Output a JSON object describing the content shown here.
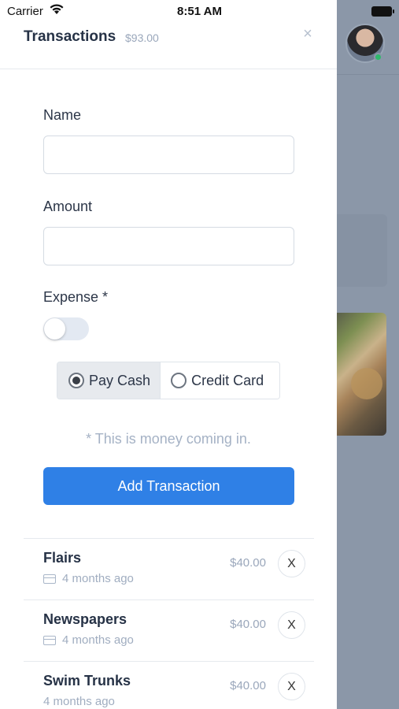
{
  "status_bar": {
    "carrier": "Carrier",
    "time": "8:51 AM"
  },
  "drawer": {
    "title": "Transactions",
    "total": "$93.00",
    "close_glyph": "×"
  },
  "form": {
    "name_label": "Name",
    "name_value": "",
    "amount_label": "Amount",
    "amount_value": "",
    "expense_label": "Expense *",
    "expense_on": false,
    "payment_options": [
      {
        "label": "Pay Cash",
        "selected": true
      },
      {
        "label": "Credit Card",
        "selected": false
      }
    ],
    "hint": "* This is money coming in.",
    "submit_label": "Add Transaction"
  },
  "transactions": [
    {
      "name": "Flairs",
      "amount": "$40.00",
      "time": "4 months ago",
      "icon": "credit-card-icon",
      "remove": "X"
    },
    {
      "name": "Newspapers",
      "amount": "$40.00",
      "time": "4 months ago",
      "icon": "credit-card-icon",
      "remove": "X"
    },
    {
      "name": "Swim Trunks",
      "amount": "$40.00",
      "time": "4 months ago",
      "icon": "",
      "remove": "X"
    }
  ],
  "colors": {
    "accent": "#2f80e6",
    "overlay": "#8b97a8",
    "online": "#2fb86b"
  }
}
